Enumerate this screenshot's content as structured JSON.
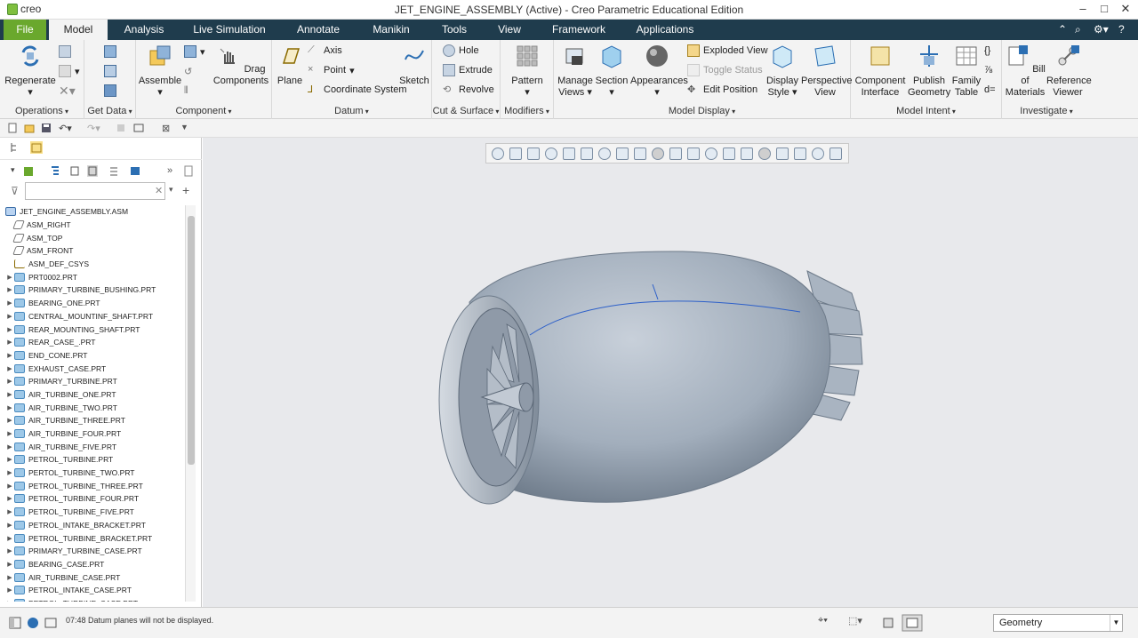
{
  "app": {
    "logo": "creo",
    "window_title": "JET_ENGINE_ASSEMBLY (Active) - Creo Parametric Educational Edition"
  },
  "menu": {
    "tabs": [
      "File",
      "Model",
      "Analysis",
      "Live Simulation",
      "Annotate",
      "Manikin",
      "Tools",
      "View",
      "Framework",
      "Applications"
    ],
    "active": "Model"
  },
  "ribbon": {
    "operations": {
      "label": "Operations",
      "regenerate": "Regenerate"
    },
    "get_data": {
      "label": "Get Data"
    },
    "component": {
      "label": "Component",
      "assemble": "Assemble",
      "drag": "Drag Components"
    },
    "datum": {
      "label": "Datum",
      "plane": "Plane",
      "axis": "Axis",
      "point": "Point",
      "csys": "Coordinate System",
      "sketch": "Sketch"
    },
    "cut_surface": {
      "label": "Cut & Surface",
      "hole": "Hole",
      "extrude": "Extrude",
      "revolve": "Revolve"
    },
    "modifiers": {
      "label": "Modifiers",
      "pattern": "Pattern"
    },
    "model_display": {
      "label": "Model Display",
      "manage_views": "Manage Views",
      "section": "Section",
      "appearances": "Appearances",
      "exploded": "Exploded View",
      "toggle": "Toggle Status",
      "edit_pos": "Edit Position",
      "display_style": "Display Style",
      "perspective": "Perspective View"
    },
    "model_intent": {
      "label": "Model Intent",
      "comp_iface": "Component Interface",
      "publish": "Publish Geometry",
      "family": "Family Table"
    },
    "investigate": {
      "label": "Investigate",
      "bom": "Bill of Materials",
      "ref_viewer": "Reference Viewer"
    }
  },
  "tree": {
    "root": "JET_ENGINE_ASSEMBLY.ASM",
    "items": [
      {
        "name": "ASM_RIGHT",
        "kind": "plane"
      },
      {
        "name": "ASM_TOP",
        "kind": "plane"
      },
      {
        "name": "ASM_FRONT",
        "kind": "plane"
      },
      {
        "name": "ASM_DEF_CSYS",
        "kind": "csys"
      },
      {
        "name": "PRT0002.PRT",
        "kind": "part"
      },
      {
        "name": "PRIMARY_TURBINE_BUSHING.PRT",
        "kind": "part"
      },
      {
        "name": "BEARING_ONE.PRT",
        "kind": "part"
      },
      {
        "name": "CENTRAL_MOUNTINF_SHAFT.PRT",
        "kind": "part"
      },
      {
        "name": "REAR_MOUNTING_SHAFT.PRT",
        "kind": "part"
      },
      {
        "name": "REAR_CASE_.PRT",
        "kind": "part"
      },
      {
        "name": "END_CONE.PRT",
        "kind": "part"
      },
      {
        "name": "EXHAUST_CASE.PRT",
        "kind": "part"
      },
      {
        "name": "PRIMARY_TURBINE.PRT",
        "kind": "part"
      },
      {
        "name": "AIR_TURBINE_ONE.PRT",
        "kind": "part"
      },
      {
        "name": "AIR_TURBINE_TWO.PRT",
        "kind": "part"
      },
      {
        "name": "AIR_TURBINE_THREE.PRT",
        "kind": "part"
      },
      {
        "name": "AIR_TURBINE_FOUR.PRT",
        "kind": "part"
      },
      {
        "name": "AIR_TURBINE_FIVE.PRT",
        "kind": "part"
      },
      {
        "name": "PETROL_TURBINE.PRT",
        "kind": "part"
      },
      {
        "name": "PERTOL_TURBINE_TWO.PRT",
        "kind": "part"
      },
      {
        "name": "PETROL_TURBINE_THREE.PRT",
        "kind": "part"
      },
      {
        "name": "PETROL_TURBINE_FOUR.PRT",
        "kind": "part"
      },
      {
        "name": "PETROL_TURBINE_FIVE.PRT",
        "kind": "part"
      },
      {
        "name": "PETROL_INTAKE_BRACKET.PRT",
        "kind": "part"
      },
      {
        "name": "PETROL_TURBINE_BRACKET.PRT",
        "kind": "part"
      },
      {
        "name": "PRIMARY_TURBINE_CASE.PRT",
        "kind": "part"
      },
      {
        "name": "BEARING_CASE.PRT",
        "kind": "part"
      },
      {
        "name": "AIR_TURBINE_CASE.PRT",
        "kind": "part"
      },
      {
        "name": "PETROL_INTAKE_CASE.PRT",
        "kind": "part"
      },
      {
        "name": "PETROL_TURBINE_CASE.PRT",
        "kind": "part"
      }
    ]
  },
  "status": {
    "message": "07:48 Datum planes will not be displayed.",
    "filter_value": "Geometry"
  },
  "colors": {
    "menubar": "#1f3c4d",
    "file_tab": "#6aa82d",
    "viewport": "#e8e9ec",
    "model": "#a9b4c1"
  }
}
